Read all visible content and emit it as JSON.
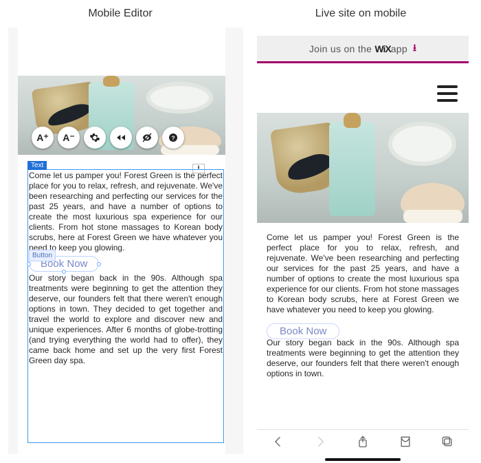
{
  "labels": {
    "left": "Mobile Editor",
    "right": "Live site on mobile"
  },
  "editor": {
    "sel_label": "Text",
    "btn_sel_label": "Button",
    "toolbar_icons": [
      "font-increase-icon",
      "font-decrease-icon",
      "gear-icon",
      "rewind-icon",
      "hide-icon",
      "help-icon"
    ],
    "download_glyph": "⭳",
    "toolbar_glyphs": {
      "font_increase": "A⁺",
      "font_decrease": "A⁻"
    }
  },
  "content": {
    "para1": "Come let us pamper you! Forest Green is the perfect place for you to relax, refresh, and rejuvenate. We've been researching and perfecting our services for the past 25 years, and have a number of options to create the most luxurious spa experience for our clients. From hot stone massages to Korean body scrubs, here at Forest Green we have whatever you need to keep you glowing.",
    "cta": "Book Now",
    "para2_full": "Our story began back in the 90s. Although spa treatments were beginning to get the attention they deserve, our founders felt that there weren't enough options in town. They decided to get together and travel the world to explore and discover new and unique experiences. After 6 months of globe-trotting (and trying everything the world had to offer), they came back home and set up the very first Forest Green day spa.",
    "para2_short": "Our story began back in the 90s. Although spa treatments were beginning to get the attention they deserve, our founders felt that there weren't enough options in town."
  },
  "live": {
    "banner_pre": "Join us on the ",
    "banner_brand": "WiX",
    "banner_post": "app",
    "dl_glyph": "⭳"
  },
  "colors": {
    "sel_blue": "#1f6fd8",
    "btn_violet": "#7a88c8",
    "brand_magenta": "#a4006b"
  }
}
